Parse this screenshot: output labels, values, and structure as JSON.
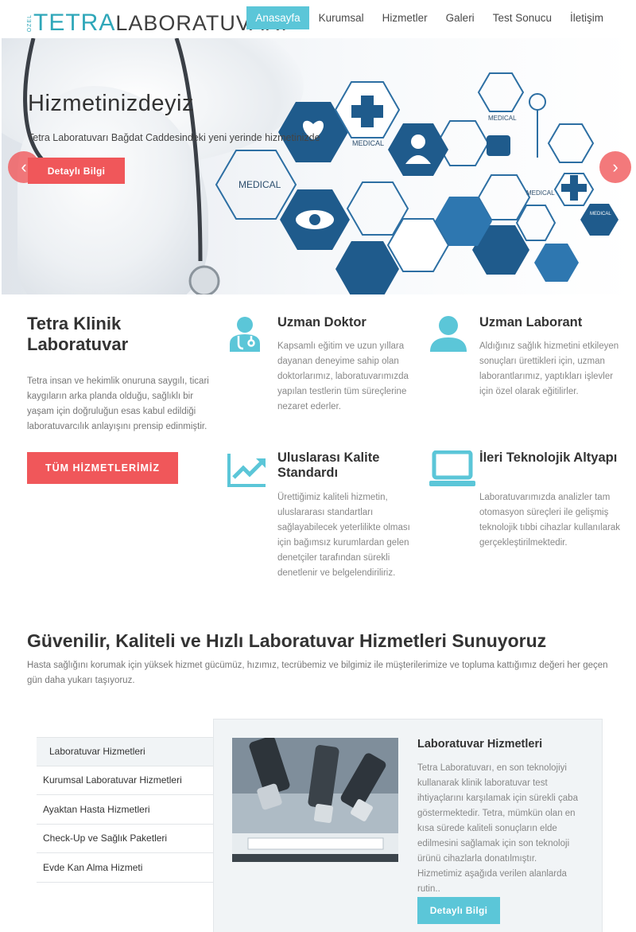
{
  "header": {
    "logo": {
      "ozel": "ÖZEL",
      "tetra": "TETRA",
      "lab": "LABORATUVARI"
    },
    "nav": [
      "Anasayfa",
      "Kurumsal",
      "Hizmetler",
      "Galeri",
      "Test Sonucu",
      "İletişim"
    ]
  },
  "hero": {
    "title": "Hizmetinizdeyiz",
    "subtitle": "Tetra Laboratuvarı Bağdat Caddesindeki yeni yerinde hizmetinizde",
    "button": "Detaylı Bilgi",
    "hex_labels": [
      "MEDICAL",
      "MEDICAL",
      "MEDICAL",
      "MEDICAL",
      "MEDICAL"
    ]
  },
  "intro": {
    "title_bold": "Tetra",
    "title_rest": "Klinik",
    "title_line2": "Laboratuvar",
    "text": "Tetra insan ve hekimlik onuruna saygılı, ticari kaygıların arka planda olduğu, sağlıklı bir yaşam için doğruluğun esas kabul edildiği laboratuvarcılık anlayışını prensip edinmiştir.",
    "button": "TÜM HİZMETLERİMİZ"
  },
  "features": [
    {
      "title": "Uzman Doktor",
      "icon": "doctor-icon",
      "text": "Kapsamlı eğitim ve uzun yıllara dayanan deneyime sahip olan doktorlarımız, laboratuvarımızda yapılan testlerin tüm süreçlerine nezaret ederler."
    },
    {
      "title": "Uzman Laborant",
      "icon": "user-icon",
      "text": "Aldığınız sağlık hizmetini etkileyen sonuçları ürettikleri için, uzman laborantlarımız, yaptıkları işlevler için özel olarak eğitilirler."
    },
    {
      "title": "Uluslarası Kalite Standardı",
      "icon": "chart-trend-icon",
      "text": "Ürettiğimiz kaliteli hizmetin, uluslararası standartları sağlayabilecek yeterlilikte olması için bağımsız kurumlardan gelen denetçiler tarafından sürekli denetlenir ve belgelendiriliriz."
    },
    {
      "title": "İleri Teknolojik Altyapı",
      "icon": "laptop-icon",
      "text": "Laboratuvarımızda analizler tam otomasyon süreçleri ile gelişmiş teknolojik tıbbi cihazlar kullanılarak gerçekleştirilmektedir."
    }
  ],
  "tagline": {
    "b1": "Güvenilir,",
    "b2": "Kaliteli",
    "w1": "ve",
    "b3": "Hızlı",
    "rest": "Laboratuvar Hizmetleri Sunuyoruz",
    "text": "Hasta sağlığını korumak için yüksek hizmet gücümüz, hızımız, tecrübemiz ve bilgimiz ile müşterilerimize ve topluma kattığımız değeri her geçen gün daha yukarı taşıyoruz."
  },
  "services": {
    "tabs": [
      "Laboratuvar Hizmetleri",
      "Kurumsal Laboratuvar Hizmetleri",
      "Ayaktan Hasta Hizmetleri",
      "Check-Up ve Sağlık Paketleri",
      "Evde Kan Alma Hizmeti"
    ],
    "active_title": "Laboratuvar Hizmetleri",
    "active_text": "Tetra Laboratuvarı, en son teknolojiyi kullanarak klinik laboratuvar test ihtiyaçlarını karşılamak için sürekli çaba göstermektedir. Tetra, mümkün olan en kısa sürede kaliteli sonuçların elde edilmesini sağlamak için son teknoloji ürünü cihazlarla donatılmıştır. Hizmetimiz aşağıda verilen alanlarda rutin..",
    "button": "Detaylı Bilgi"
  },
  "colors": {
    "accent_red": "#f0575a",
    "accent_teal": "#5bc6d8",
    "hex_blue": "#1f5b8c"
  }
}
